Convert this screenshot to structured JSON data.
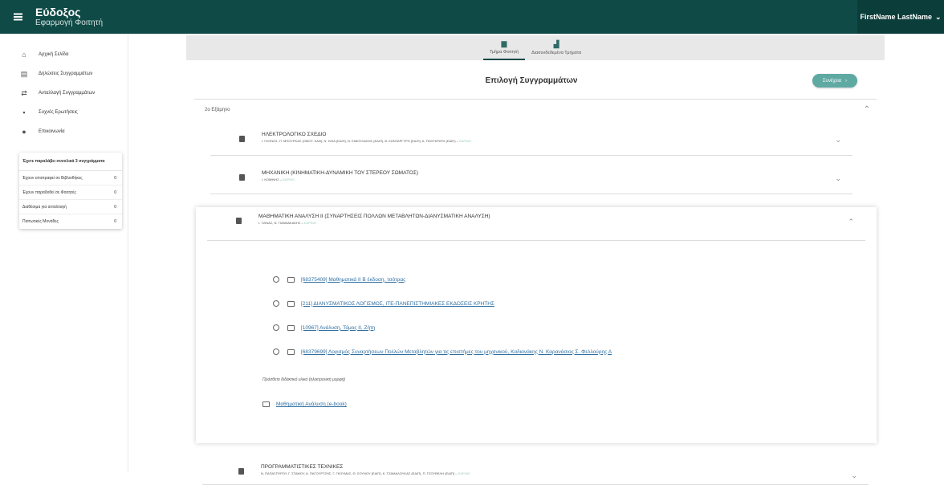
{
  "app": {
    "title": "Εύδοξος",
    "subtitle": "Εφαρμογή Φοιτητή",
    "user": "FirstName LastName"
  },
  "sidebar": {
    "items": [
      {
        "label": "Αρχική Σελίδα",
        "icon": "home-icon"
      },
      {
        "label": "Δηλώσεις Συγγραμμάτων",
        "icon": "list-icon"
      },
      {
        "label": "Ανταλλαγή Συγγραμμάτων",
        "icon": "swap-icon"
      },
      {
        "label": "Συχνές Ερωτήσεις",
        "icon": "faq-icon"
      },
      {
        "label": "Επικοινωνία",
        "icon": "contact-icon"
      }
    ],
    "stats": {
      "heading": "Έχετε παραλάβει συνολικά 3 συγγράμματα",
      "rows": [
        {
          "label": "Έχουν επιστραφεί σε Βιβλιοθήκες",
          "value": "0"
        },
        {
          "label": "Έχουν παραδοθεί σε Φοιτητές",
          "value": "0"
        },
        {
          "label": "Διαθέσιμα για ανταλλαγή",
          "value": "0"
        },
        {
          "label": "Πιστωτικές Μονάδες",
          "value": "0"
        }
      ]
    }
  },
  "tabs": [
    {
      "label": "Τμήμα Φοιτητή",
      "active": true
    },
    {
      "label": "Διασυνδεδεμένα Τμήματα",
      "active": false
    }
  ],
  "main": {
    "title": "Επιλογή Συγγραμμάτων",
    "next_label": "Συνέχεια",
    "semester": "2ο Εξάμηνο",
    "courses": [
      {
        "title": "ΗΛΕΚΤΡΟΛΟΓΙΚΟ ΣΧΕΔΙΟ",
        "authors": "Ι. ΓΚΟΝΟΣ, Π. ΜΠΟΥΡΚΑΣ (ΟΜΟΤ. ΚΑΘ), Ν. ΗΛΙΑ (ΕΔΙΠ), Ν. ΚΙΜΟΥΛΑΚΗΣ (ΕΔΙΠ), Β. ΚΟΝΤΑΡΓΥΡΗ (ΕΔΙΠ), Α. ΠΟΛΥΚΡΑΤΗ (ΕΔΙΠ)",
        "season": "ΕΑΡΙΝΟ"
      },
      {
        "title": "ΜΗΧΑΝΙΚΗ (ΚΙΝΗΜΑΤΙΚΗ-ΔΥΝΑΜΙΚΗ ΤΟΥ ΣΤΕΡΕΟΥ ΣΩΜΑΤΟΣ)",
        "authors": "Ι. ΚΟΜΙΝΗΣ",
        "season": "ΕΑΡΙΝΟ"
      },
      {
        "title": "ΜΑΘΗΜΑΤΙΚΗ ΑΝΑΛΥΣΗ ΙΙ (ΣΥΝΑΡΤΗΣΕΙΣ ΠΟΛΛΩΝ ΜΕΤΑΒΛΗΤΩΝ-ΔΙΑΝΥΣΜΑΤΙΚΗ ΑΝΑΛΥΣΗ)",
        "authors": "Ι. ΤΖΙΝΑΣ, Ν. ΓΙΑΝΝΑΚΑΚΗΣ",
        "season": "ΕΑΡΙΝΟ"
      },
      {
        "title": "ΠΡΟΓΡΑΜΜΑΤΙΣΤΙΚΕΣ ΤΕΧΝΙΚΕΣ",
        "authors": "Ν. ΠΑΠΑΣΠΥΡΟΥ, Γ. ΣΤΑΜΟΥ, Α. ΠΑΓΟΥΡΤΖΗΣ, Γ. ΓΚΟΥΜΑΣ, Θ. ΣΟΥΝΟΥ (ΕΔΙΠ), Κ. ΤΖΑΜΑΛΟΥΚΑΣ (ΕΔΙΠ), Π. ΤΖΟΥΒΕΛΗ (ΕΔΙΠ)",
        "season": "ΕΑΡΙΝΟ"
      }
    ],
    "options": [
      "[68375409] Μαθηματικά ΙΙ Β έκδοση, τσότρας",
      "[211] ΔΙΑΝΥΣΜΑΤΙΚΟΣ ΛΟΓΙΣΜΟΣ, ΙΤΕ-ΠΑΝΕΠΙΣΤΗΜΙΑΚΕΣ ΕΚΔΟΣΕΙΣ ΚΡΗΤΗΣ",
      "[10967] Ανάλυση, Τόμος ΙΙ, Ζήτη",
      "[68379699] Λογισμός Συναρτήσεων Πολλών Μεταβλητών για τις επιστήμες του μηχανικού, Καδιανάκης Ν. Καρανάσιος Σ. Φελλούρης Α"
    ],
    "extra_label": "Πρόσθετο διδακτικό υλικό (ηλεκτρονική μορφή)",
    "ebook": "Μαθηματική Ανάλυση (e-book)"
  }
}
